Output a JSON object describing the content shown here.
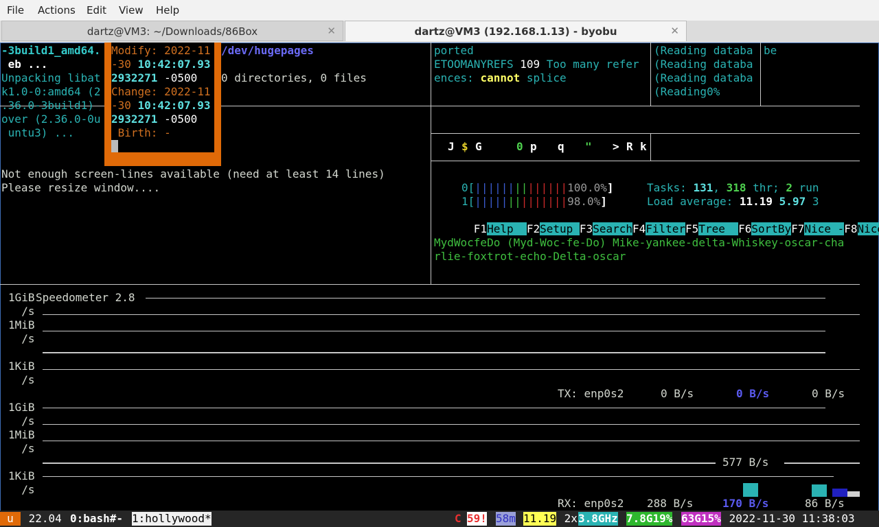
{
  "menubar": {
    "items": [
      "File",
      "Actions",
      "Edit",
      "View",
      "Help"
    ]
  },
  "tabs": [
    {
      "label": "dartz@VM3: ~/Downloads/86Box",
      "active": false
    },
    {
      "label": "dartz@VM3 (192.168.1.13) - byobu",
      "active": true
    }
  ],
  "pane_install": {
    "lines": [
      "-3build1_amd64.",
      " eb ...",
      "Unpacking libat",
      "k1.0-0:amd64 (2",
      ".36.0-3build1)",
      "over (2.36.0-0u",
      " untu3) ..."
    ]
  },
  "pane_stat": {
    "modify_label": "Modify: 2022-11",
    "modify_date_tail": "-30 ",
    "modify_time": "10:42:07.93",
    "modify_frac": "2932271",
    "modify_tz": " -0500",
    "change_label": "Change: 2022-11",
    "change_date_tail": "-30 ",
    "change_time": "10:42:07.93",
    "change_frac": "2932271",
    "change_tz": " -0500",
    "birth_label": " Birth: -"
  },
  "pane_tree": {
    "path": "/dev/hugepages",
    "summary": "0 directories, 0 files"
  },
  "pane_error": {
    "line1": "ported",
    "line2a": "ETOOMANYREFS",
    "line2b": " 109 ",
    "line2c": "Too many refer",
    "line3a": "ences: ",
    "line3b": "cannot",
    "line3c": " splice"
  },
  "pane_reading": {
    "lines": [
      "(Reading databa",
      "(Reading databa",
      "(Reading databa",
      "(Reading0%"
    ],
    "side": "be"
  },
  "pane_keys": {
    "letters": [
      {
        "ch": "J",
        "c": "#fff"
      },
      {
        "ch": "$",
        "c": "#e6d02a"
      },
      {
        "ch": "G",
        "c": "#fff"
      },
      {
        "ch": "0",
        "c": "#4fd14f"
      },
      {
        "ch": "p",
        "c": "#fff"
      },
      {
        "ch": "q",
        "c": "#fff"
      },
      {
        "ch": "\"",
        "c": "#4fd14f"
      },
      {
        "ch": ">",
        "c": "#fff"
      },
      {
        "ch": "R",
        "c": "#fff"
      },
      {
        "ch": "k",
        "c": "#fff"
      }
    ]
  },
  "pane_resize": {
    "line1": "Not enough screen-lines available (need at least 14 lines)",
    "line2": "Please resize window...."
  },
  "htop": {
    "cpu0_label": "0[",
    "cpu0_pct": "100.0%",
    "cpu0_value": 100.0,
    "cpu1_label": "1[",
    "cpu1_pct": "98.0%",
    "cpu1_value": 98.0,
    "close": "]",
    "tasks_label": "Tasks: ",
    "tasks": "131",
    "sep": ", ",
    "threads": "318",
    "thr_label": " thr; ",
    "running": "2",
    "run_label": " run",
    "load_label": "Load average: ",
    "load1": "11.19",
    "load5": "5.97",
    "load15": "3",
    "fkeys": [
      {
        "n": "F1",
        "l": "Help  "
      },
      {
        "n": "F2",
        "l": "Setup "
      },
      {
        "n": "F3",
        "l": "Search"
      },
      {
        "n": "F4",
        "l": "Filter"
      },
      {
        "n": "F5",
        "l": "Tree  "
      },
      {
        "n": "F6",
        "l": "SortBy"
      },
      {
        "n": "F7",
        "l": "Nice -"
      },
      {
        "n": "F8",
        "l": "Nice"
      }
    ]
  },
  "pane_phonetic": {
    "line1": "MydWocfeDo (Myd-Woc-fe-Do) Mike-yankee-delta-Whiskey-oscar-cha",
    "line2": "rlie-foxtrot-echo-Delta-oscar"
  },
  "speedometer": {
    "title": "Speedometer 2.8",
    "tx_scale": [
      "1GiB",
      "  /s",
      "1MiB",
      "  /s",
      "1KiB",
      "  /s"
    ],
    "rx_scale": [
      "1GiB",
      "  /s",
      "1MiB",
      "  /s",
      "1KiB",
      "  /s"
    ],
    "tx_label": "TX: enp0s2",
    "tx_v1": "0 B/s",
    "tx_v2": "0 B/s",
    "tx_v3": "0 B/s",
    "rx_mark": "577 B/s",
    "rx_label": "RX: enp0s2",
    "rx_v1": "288 B/s",
    "rx_v2": "170 B/s",
    "rx_v3": "86 B/s"
  },
  "statusbar": {
    "logo": "u",
    "release": " 22.04 ",
    "win0": "0:bash#-",
    "win1": "1:hollywood*",
    "reboot_icon": "C",
    "updates": "59!",
    "uptime": "58m",
    "load": "11.19",
    "cpu_count": " 2x",
    "cpu_freq": "3.8GHz",
    "mem": "7.8G19%",
    "disk": "63G15%",
    "datetime": " 2022-11-30 11:38:03"
  },
  "colors": {
    "orange": "#e06a08",
    "cyan": "#2ab3b3",
    "teal_text": "#34c9c9",
    "status_bg": "#262626",
    "blue": "#5a5af0",
    "green": "#3fbf3f"
  }
}
